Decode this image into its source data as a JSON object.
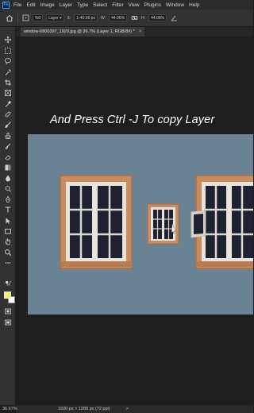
{
  "app": {
    "logo": "Ps"
  },
  "menu": [
    "File",
    "Edit",
    "Image",
    "Layer",
    "Type",
    "Select",
    "Filter",
    "View",
    "Plugins",
    "Window",
    "Help"
  ],
  "options": {
    "reference_point": "%0",
    "layer_label": "Layer",
    "x_label": "X:",
    "x_value": "1-40.00 px",
    "w_label": "W:",
    "w_value": "44.06%",
    "h_label": "H:",
    "h_value": "44.06%"
  },
  "document": {
    "tab_title": "window-6800397_1920.jpg @ 36.7% (Layer 1, RGB/8#) *",
    "close_symbol": "×"
  },
  "caption": "And Press Ctrl  -J  To copy Layer",
  "status": {
    "zoom": "36.67%",
    "doc_size": "1920 px × 1280 px (72 ppi)",
    "arrow": ">"
  },
  "colors": {
    "foreground": "#f0f06a",
    "background": "#ffffff",
    "wall": "#6a8394",
    "frame": "#c98c5e"
  },
  "icons": [
    "home-icon",
    "move-tool-icon",
    "marquee-tool-icon",
    "lasso-tool-icon",
    "magic-wand-icon",
    "crop-tool-icon",
    "frame-tool-icon",
    "eyedropper-icon",
    "healing-brush-icon",
    "brush-icon",
    "clone-stamp-icon",
    "history-brush-icon",
    "eraser-icon",
    "gradient-icon",
    "blur-icon",
    "dodge-icon",
    "pen-icon",
    "type-icon",
    "path-select-icon",
    "rectangle-icon",
    "hand-icon",
    "zoom-icon",
    "more-tools-icon",
    "swap-colors-icon",
    "quick-mask-icon",
    "screen-mode-icon"
  ]
}
